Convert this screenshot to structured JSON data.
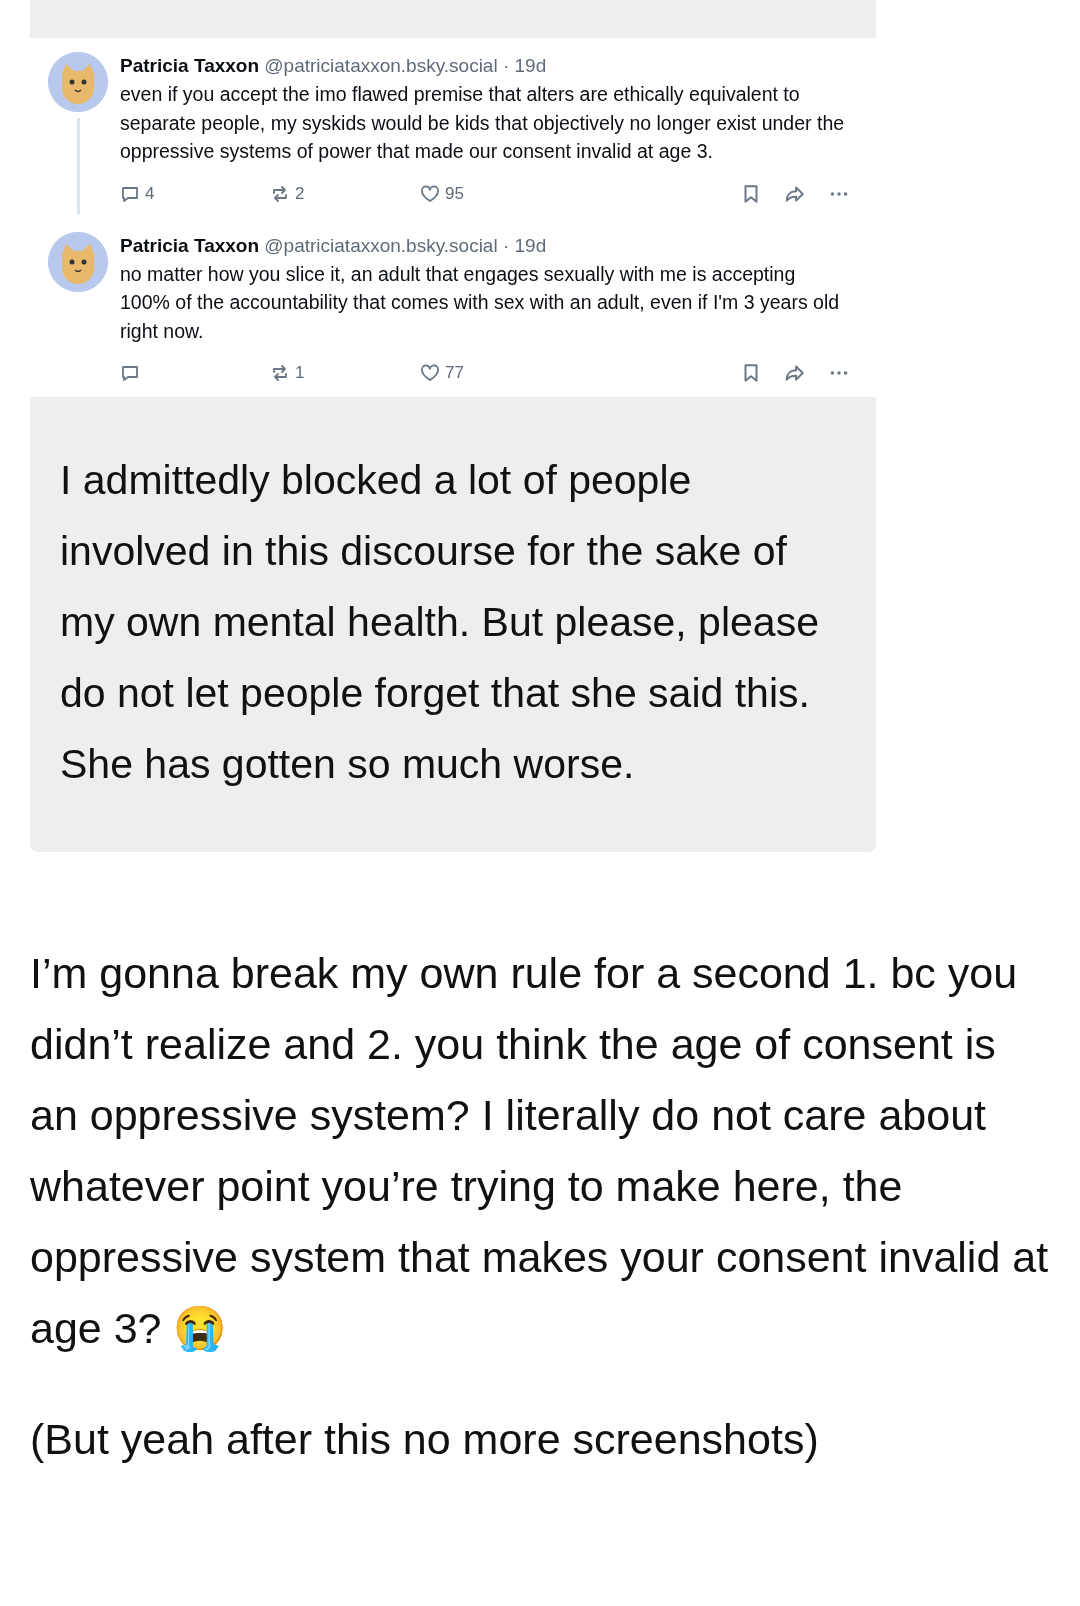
{
  "posts": [
    {
      "author": "Patricia Taxxon",
      "handle": "@patriciataxxon.bsky.social",
      "time": "· 19d",
      "text": "even if you accept the imo flawed premise that alters are ethically equivalent to separate people, my syskids would be kids that objectively no longer exist under the oppressive systems of power that made our consent invalid at age 3.",
      "replies": "4",
      "reposts": "2",
      "likes": "95",
      "thread_continues": true
    },
    {
      "author": "Patricia Taxxon",
      "handle": "@patriciataxxon.bsky.social",
      "time": "· 19d",
      "text": "no matter how you slice it, an adult that engages sexually with me is accepting 100% of the accountability that comes with sex with an adult, even if I'm 3 years old right now.",
      "reposts": "1",
      "likes": "77",
      "thread_continues": false
    }
  ],
  "quote": "I admittedly blocked a lot of people involved in this discourse for the sake of my own mental health. But please, please do not let people forget that she said this. She has gotten so much worse.",
  "paragraphs": [
    "I’m gonna break my own rule for a second 1. bc you didn’t realize and 2. you think the age of consent is an oppressive system? I literally do not care about whatever point you’re trying to make here, the oppressive system that makes your consent invalid at age 3? 😭",
    "(But yeah after this no more screenshots)"
  ]
}
